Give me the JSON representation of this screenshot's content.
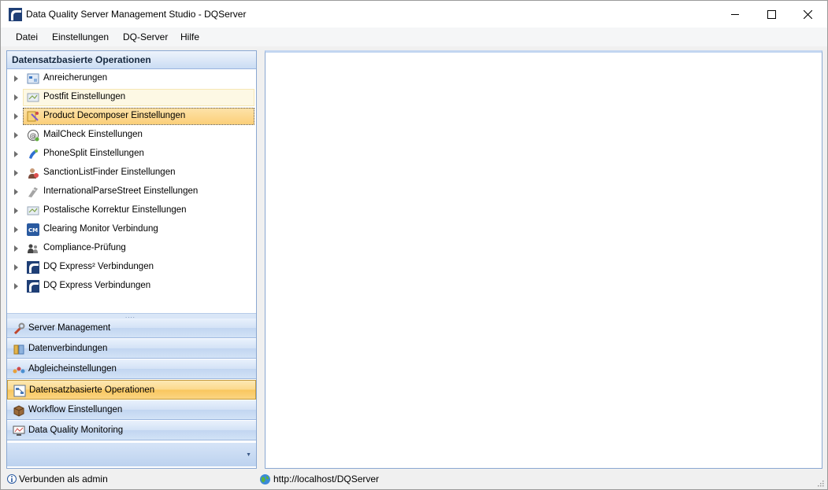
{
  "window": {
    "title": "Data Quality Server Management Studio - DQServer",
    "controls": [
      "minimize-icon",
      "maximize-icon",
      "close-icon"
    ]
  },
  "menu": [
    "Datei",
    "Einstellungen",
    "DQ-Server",
    "Hilfe"
  ],
  "left_pane": {
    "header": "Datensatzbasierte Operationen",
    "tree_items": [
      {
        "label": "Anreicherungen",
        "icon": "enrichment-icon"
      },
      {
        "label": "Postfit Einstellungen",
        "icon": "postfit-icon"
      },
      {
        "label": "Product Decomposer Einstellungen",
        "icon": "product-decomposer-icon"
      },
      {
        "label": "MailCheck Einstellungen",
        "icon": "mailcheck-icon"
      },
      {
        "label": "PhoneSplit Einstellungen",
        "icon": "phonesplit-icon"
      },
      {
        "label": "SanctionListFinder Einstellungen",
        "icon": "sanctionlist-icon"
      },
      {
        "label": "InternationalParseStreet Einstellungen",
        "icon": "parsestreet-icon"
      },
      {
        "label": "Postalische Korrektur Einstellungen",
        "icon": "postal-correction-icon"
      },
      {
        "label": "Clearing Monitor Verbindung",
        "icon": "clearing-monitor-icon"
      },
      {
        "label": "Compliance-Prüfung",
        "icon": "compliance-icon"
      },
      {
        "label": "DQ Express² Verbindungen",
        "icon": "dq-express2-icon"
      },
      {
        "label": "DQ Express Verbindungen",
        "icon": "dq-express-icon"
      }
    ],
    "hovered_index": 1,
    "selected_index": 2,
    "nav_buttons": [
      {
        "label": "Server Management",
        "icon": "wrench-icon"
      },
      {
        "label": "Datenverbindungen",
        "icon": "database-icon"
      },
      {
        "label": "Abgleicheinstellungen",
        "icon": "matching-icon"
      },
      {
        "label": "Datensatzbasierte Operationen",
        "icon": "record-operations-icon"
      },
      {
        "label": "Workflow Einstellungen",
        "icon": "workflow-icon"
      },
      {
        "label": "Data Quality Monitoring",
        "icon": "monitoring-icon"
      }
    ],
    "active_nav_index": 3
  },
  "status": {
    "connection": "Verbunden als admin",
    "url": "http://localhost/DQServer"
  },
  "colors": {
    "accent": "#fbd98c",
    "pane_border": "#8aa8d2",
    "header_text": "#15283f"
  }
}
